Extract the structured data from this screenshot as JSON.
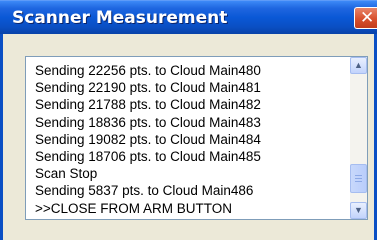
{
  "window": {
    "title": "Scanner Measurement",
    "close_symbol": "✕"
  },
  "log": {
    "lines": [
      "Sending 22256 pts. to Cloud Main480",
      "Sending 22190 pts. to Cloud Main481",
      "Sending 21788 pts. to Cloud Main482",
      "Sending 18836 pts. to Cloud Main483",
      "Sending 19082 pts. to Cloud Main484",
      "Sending 18706 pts. to Cloud Main485",
      "Scan Stop",
      "Sending 5837 pts. to Cloud Main486",
      ">>CLOSE FROM ARM BUTTON"
    ]
  },
  "scrollbar": {
    "up_arrow": "▲",
    "down_arrow": "▼"
  }
}
